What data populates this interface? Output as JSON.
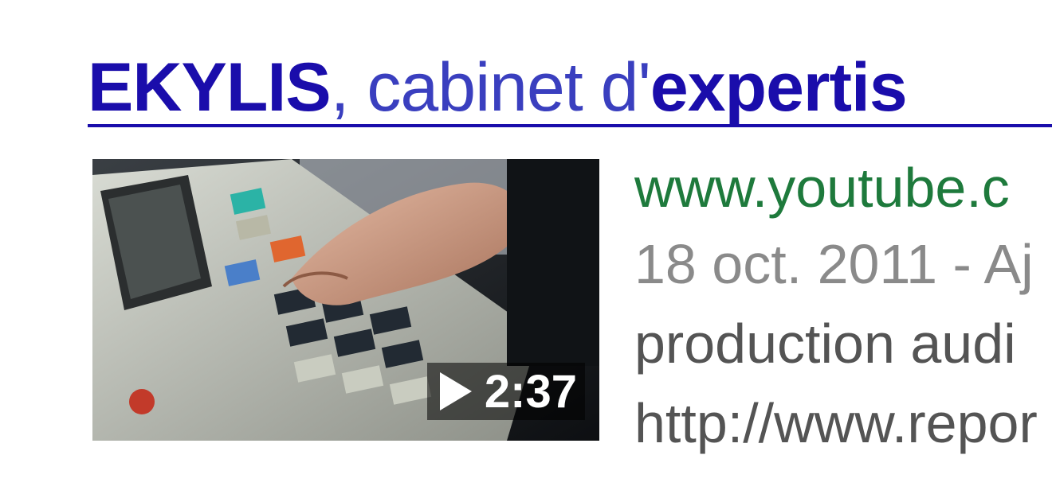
{
  "result": {
    "title_bold_1": "EKYLIS",
    "title_plain": ", cabinet d'",
    "title_bold_2": "expertis",
    "url": "www.youtube.c",
    "date": "18 oct. 2011 - Aj",
    "snippet_line_1": "production audi",
    "snippet_line_2": "http://www.repor"
  },
  "thumbnail": {
    "duration": "2:37",
    "play_icon": "play-icon"
  },
  "colors": {
    "title": "#1a0dab",
    "url": "#1e7a3c",
    "meta": "#8a8a8a",
    "snippet": "#545454"
  }
}
